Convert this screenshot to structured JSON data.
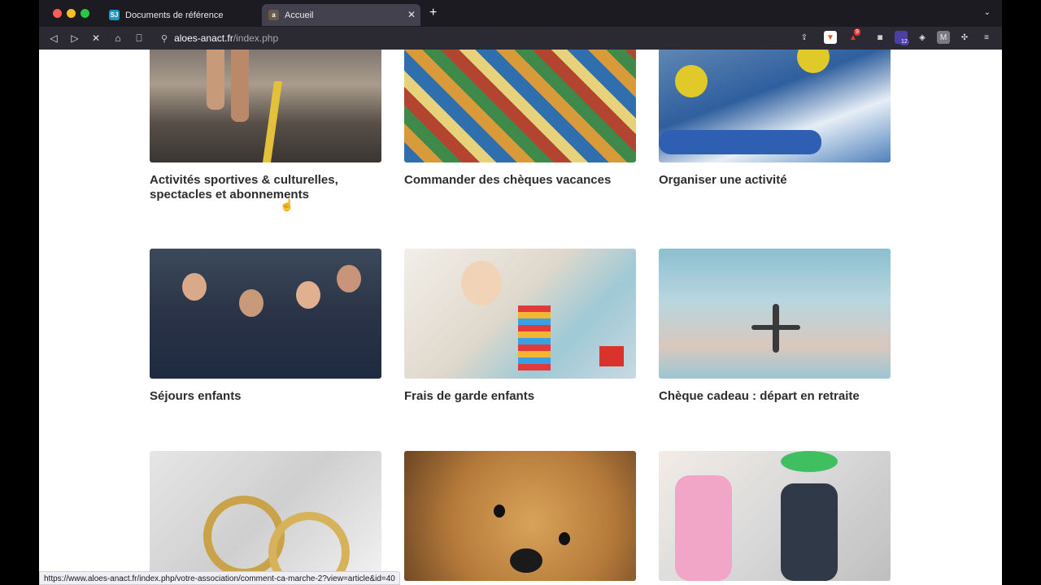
{
  "browser": {
    "tabs": [
      {
        "label": "Documents de référence",
        "favicon": "SJ"
      },
      {
        "label": "Accueil",
        "favicon": "a"
      }
    ],
    "url_domain": "aloes-anact.fr",
    "url_path": "/index.php",
    "extension_badge": "9",
    "profile_badge": "12",
    "status_url": "https://www.aloes-anact.fr/index.php/votre-association/comment-ca-marche-2?view=article&id=40"
  },
  "cards": [
    {
      "title": "Activités sportives & culturelles, spectacles et abonnements",
      "image": "runner"
    },
    {
      "title": "Commander des chèques vacances",
      "image": "postcards"
    },
    {
      "title": "Organiser une activité",
      "image": "rafting"
    },
    {
      "title": "Séjours enfants",
      "image": "kids-group"
    },
    {
      "title": "Frais de garde enfants",
      "image": "baby-toys"
    },
    {
      "title": "Chèque cadeau : départ en retraite",
      "image": "airplane"
    },
    {
      "title": "",
      "image": "wedding-rings"
    },
    {
      "title": "",
      "image": "teddy-bear"
    },
    {
      "title": "",
      "image": "backpacks"
    }
  ]
}
